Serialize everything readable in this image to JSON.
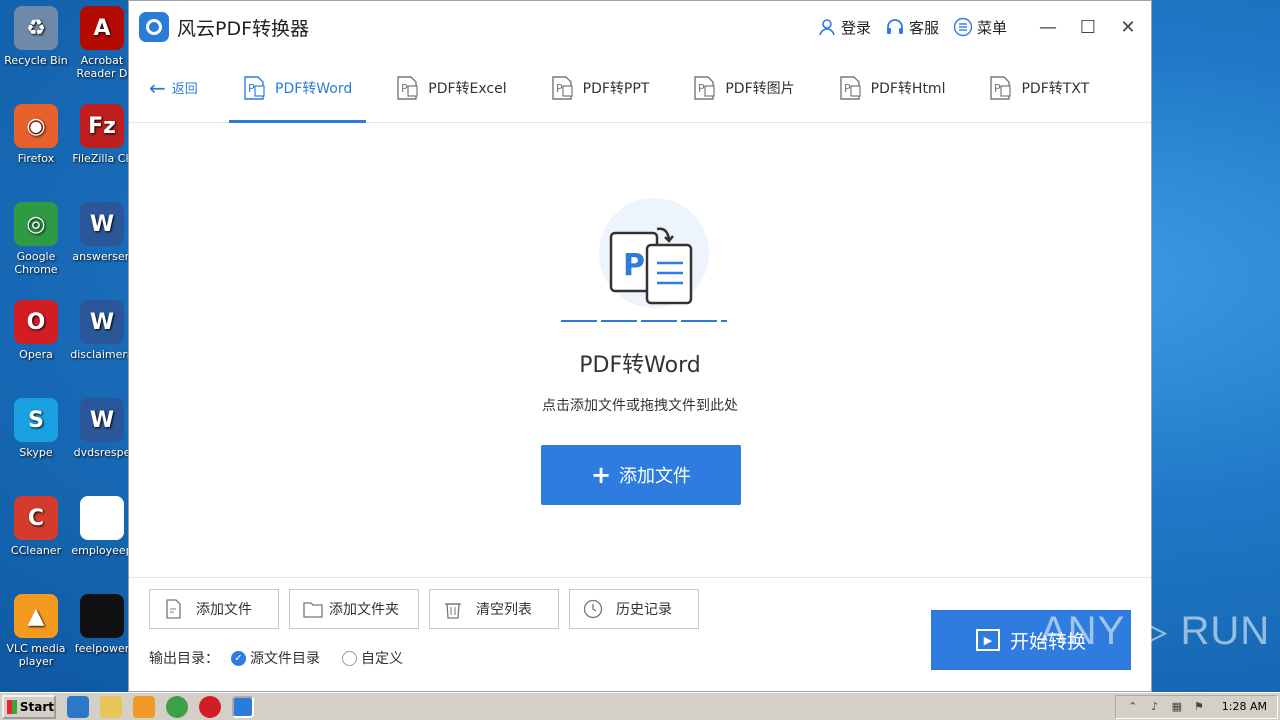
{
  "desktop": {
    "icons": [
      {
        "label": "Recycle Bin",
        "color": "#6f8aa8",
        "glyph": "♻"
      },
      {
        "label": "Firefox",
        "color": "#e8612c",
        "glyph": "◉"
      },
      {
        "label": "Google Chrome",
        "color": "#2f9a44",
        "glyph": "◎"
      },
      {
        "label": "Opera",
        "color": "#d21d25",
        "glyph": "O"
      },
      {
        "label": "Skype",
        "color": "#1aa1e1",
        "glyph": "S"
      },
      {
        "label": "CCleaner",
        "color": "#d33c2c",
        "glyph": "C"
      },
      {
        "label": "VLC media player",
        "color": "#f39a1f",
        "glyph": "▲"
      }
    ],
    "icons2": [
      {
        "label": "Acrobat Reader D",
        "color": "#b30b00",
        "glyph": "A"
      },
      {
        "label": "FileZilla Cli",
        "color": "#bf1e1e",
        "glyph": "Fz"
      },
      {
        "label": "answersen",
        "color": "#2b579a",
        "glyph": "W"
      },
      {
        "label": "disclaimern",
        "color": "#2b579a",
        "glyph": "W"
      },
      {
        "label": "dvdsrespe",
        "color": "#2b579a",
        "glyph": "W"
      },
      {
        "label": "employeep",
        "color": "#ffffff",
        "glyph": ""
      },
      {
        "label": "feelpower",
        "color": "#111111",
        "glyph": ""
      }
    ]
  },
  "app": {
    "title": "风云PDF转换器",
    "login": "登录",
    "service": "客服",
    "menu": "菜单",
    "back": "返回",
    "tabs": [
      {
        "label": "PDF转Word",
        "badge": "W"
      },
      {
        "label": "PDF转Excel",
        "badge": "E"
      },
      {
        "label": "PDF转PPT",
        "badge": "P"
      },
      {
        "label": "PDF转图片",
        "badge": "I"
      },
      {
        "label": "PDF转Html",
        "badge": "H"
      },
      {
        "label": "PDF转TXT",
        "badge": "T"
      }
    ],
    "drop_title": "PDF转Word",
    "drop_subtitle": "点击添加文件或拖拽文件到此处",
    "add_file_button": "添加文件",
    "bottom_buttons": {
      "add_file": "添加文件",
      "add_folder": "添加文件夹",
      "clear_list": "清空列表",
      "history": "历史记录"
    },
    "output_label": "输出目录：",
    "output_source": "源文件目录",
    "output_custom": "自定义",
    "start_button": "开始转换",
    "accent": "#2f7ce0"
  },
  "watermark": "ANY ▷ RUN",
  "taskbar": {
    "start": "Start",
    "time": "1:28 AM"
  }
}
